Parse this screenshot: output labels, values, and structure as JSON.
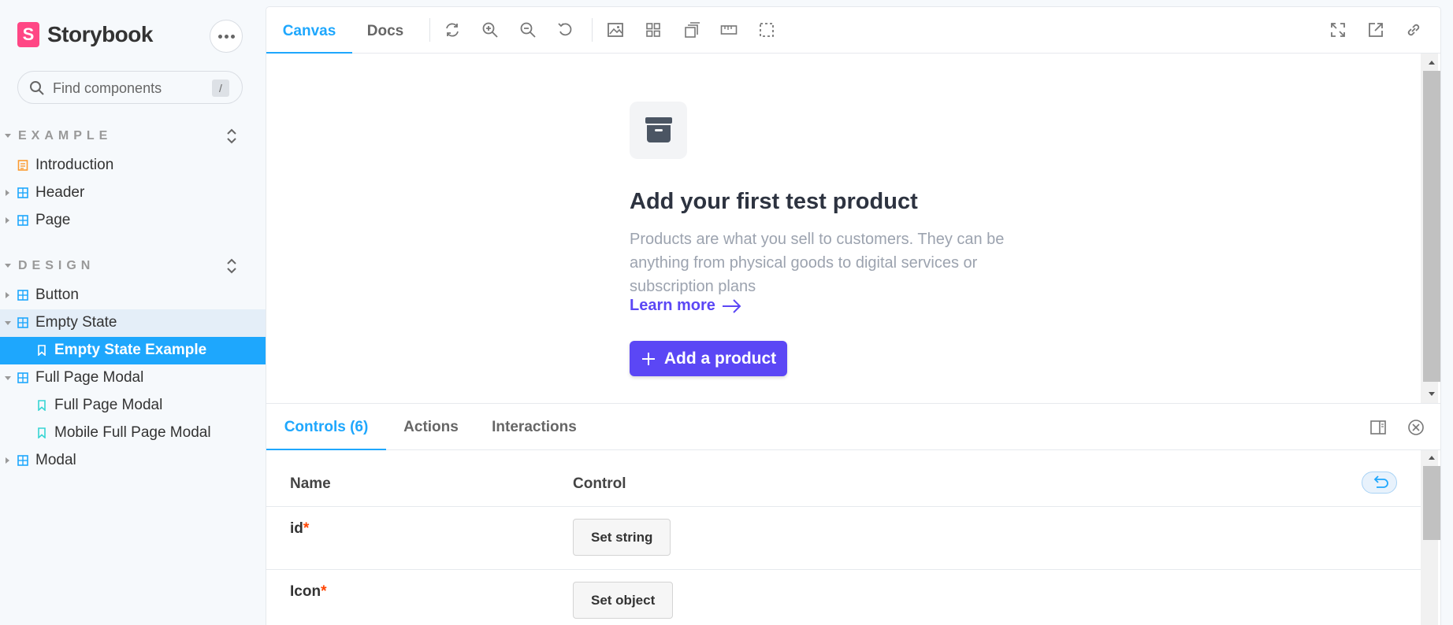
{
  "brand": {
    "name": "Storybook",
    "logo_letter": "S"
  },
  "search": {
    "placeholder": "Find components",
    "shortcut": "/"
  },
  "sidebar": {
    "sections": [
      {
        "label": "EXAMPLE"
      },
      {
        "label": "DESIGN"
      }
    ],
    "items": [
      {
        "label": "Introduction",
        "icon": "document-icon"
      },
      {
        "label": "Header",
        "icon": "component-icon"
      },
      {
        "label": "Page",
        "icon": "component-icon"
      },
      {
        "label": "Button",
        "icon": "component-icon"
      },
      {
        "label": "Empty State",
        "icon": "component-icon"
      },
      {
        "label": "Empty State Example",
        "icon": "bookmark-icon"
      },
      {
        "label": "Full Page Modal",
        "icon": "component-icon"
      },
      {
        "label": "Full Page Modal",
        "icon": "bookmark-icon"
      },
      {
        "label": "Mobile Full Page Modal",
        "icon": "bookmark-icon"
      },
      {
        "label": "Modal",
        "icon": "component-icon"
      }
    ]
  },
  "toolbar": {
    "tabs": [
      {
        "label": "Canvas"
      },
      {
        "label": "Docs"
      }
    ]
  },
  "preview": {
    "title": "Add your first test product",
    "description": "Products are what you sell to customers. They can be anything from physical goods to digital services or subscription plans",
    "link": "Learn more",
    "button": "Add a product"
  },
  "addons": {
    "tabs": [
      {
        "label": "Controls (6)"
      },
      {
        "label": "Actions"
      },
      {
        "label": "Interactions"
      }
    ]
  },
  "controls": {
    "headers": {
      "name": "Name",
      "control": "Control"
    },
    "rows": [
      {
        "name": "id",
        "required": "*",
        "button": "Set string"
      },
      {
        "name": "Icon",
        "required": "*",
        "button": "Set object"
      }
    ]
  },
  "colors": {
    "accent": "#1ea7fd",
    "brand": "#ff4785",
    "primary_button": "#5b47f5"
  }
}
